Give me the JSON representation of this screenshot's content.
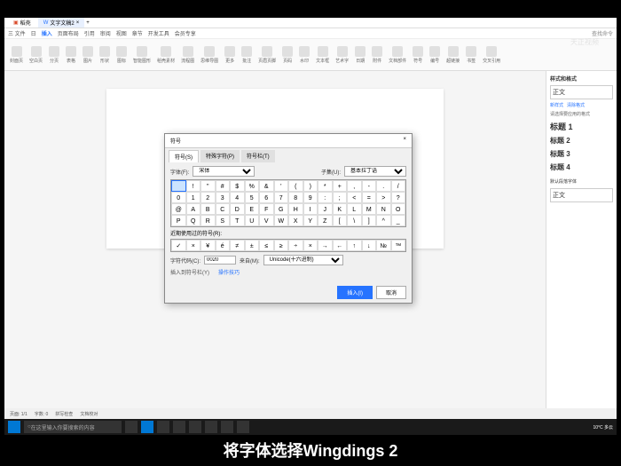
{
  "titlebar": {
    "tab1": "稻壳",
    "tab2": "文字文稿2"
  },
  "menu": {
    "items": [
      "三 文件",
      "日",
      "插入",
      "页面布局",
      "引用",
      "审阅",
      "视图",
      "章节",
      "开发工具",
      "会员专享",
      "查找命令"
    ],
    "active_index": 2
  },
  "ribbon": [
    "封面页",
    "空白页",
    "分页",
    "表格",
    "图片",
    "形状",
    "图标",
    "智能图形",
    "稻壳素材",
    "流程图",
    "思维导图",
    "更多",
    "批注",
    "页眉页脚",
    "页码",
    "水印",
    "文本框",
    "艺术字",
    "日期",
    "附件",
    "文档部件",
    "符号",
    "编号",
    "超链接",
    "书签",
    "交叉引用"
  ],
  "sidebar": {
    "section1": "样式和格式",
    "normal": "正文",
    "new": "新样式",
    "clear": "清除格式",
    "section2": "请选择要应用的格式",
    "headings": [
      "标题 1",
      "标题 2",
      "标题 3",
      "标题 4"
    ],
    "default_font": "默认段落字体",
    "body": "正文"
  },
  "dialog": {
    "title": "符号",
    "close": "×",
    "tabs": [
      "符号(S)",
      "特殊字符(P)",
      "符号栏(T)"
    ],
    "font_label": "字体(F):",
    "font_value": "宋体",
    "subset_label": "子集(U):",
    "subset_value": "基本拉丁语",
    "grid": [
      " ",
      "!",
      "\"",
      "#",
      "$",
      "%",
      "&",
      "'",
      "(",
      ")",
      "*",
      "+",
      ",",
      "-",
      ".",
      "/",
      "0",
      "1",
      "2",
      "3",
      "4",
      "5",
      "6",
      "7",
      "8",
      "9",
      ":",
      ";",
      "<",
      "=",
      ">",
      "?",
      "@",
      "A",
      "B",
      "C",
      "D",
      "E",
      "F",
      "G",
      "H",
      "I",
      "J",
      "K",
      "L",
      "M",
      "N",
      "O",
      "P",
      "Q",
      "R",
      "S",
      "T",
      "U",
      "V",
      "W",
      "X",
      "Y",
      "Z",
      "[",
      "\\",
      "]",
      "^",
      "_"
    ],
    "recent_label": "近期使用过的符号(R):",
    "recent": [
      "✓",
      "×",
      "¥",
      "é",
      "≠",
      "±",
      "≤",
      "≥",
      "÷",
      "×",
      "→",
      "←",
      "↑",
      "↓",
      "№",
      "™"
    ],
    "code_label": "字符代码(C):",
    "code_value": "0020",
    "from_label": "来自(M):",
    "from_value": "Unicode(十六进制)",
    "shortcut": "插入到符号栏(Y)",
    "operation_tip": "操作技巧",
    "insert": "插入(I)",
    "cancel": "取消"
  },
  "status": {
    "page": "页面: 1/1",
    "words": "字数: 0",
    "spell": "拼写检查",
    "doc": "文档校对"
  },
  "taskbar": {
    "search": "在这里输入你要搜索的内容",
    "time": "10°C 多云",
    "clock": ""
  },
  "subtitle": "将字体选择Wingdings 2",
  "watermark": "天正视频"
}
